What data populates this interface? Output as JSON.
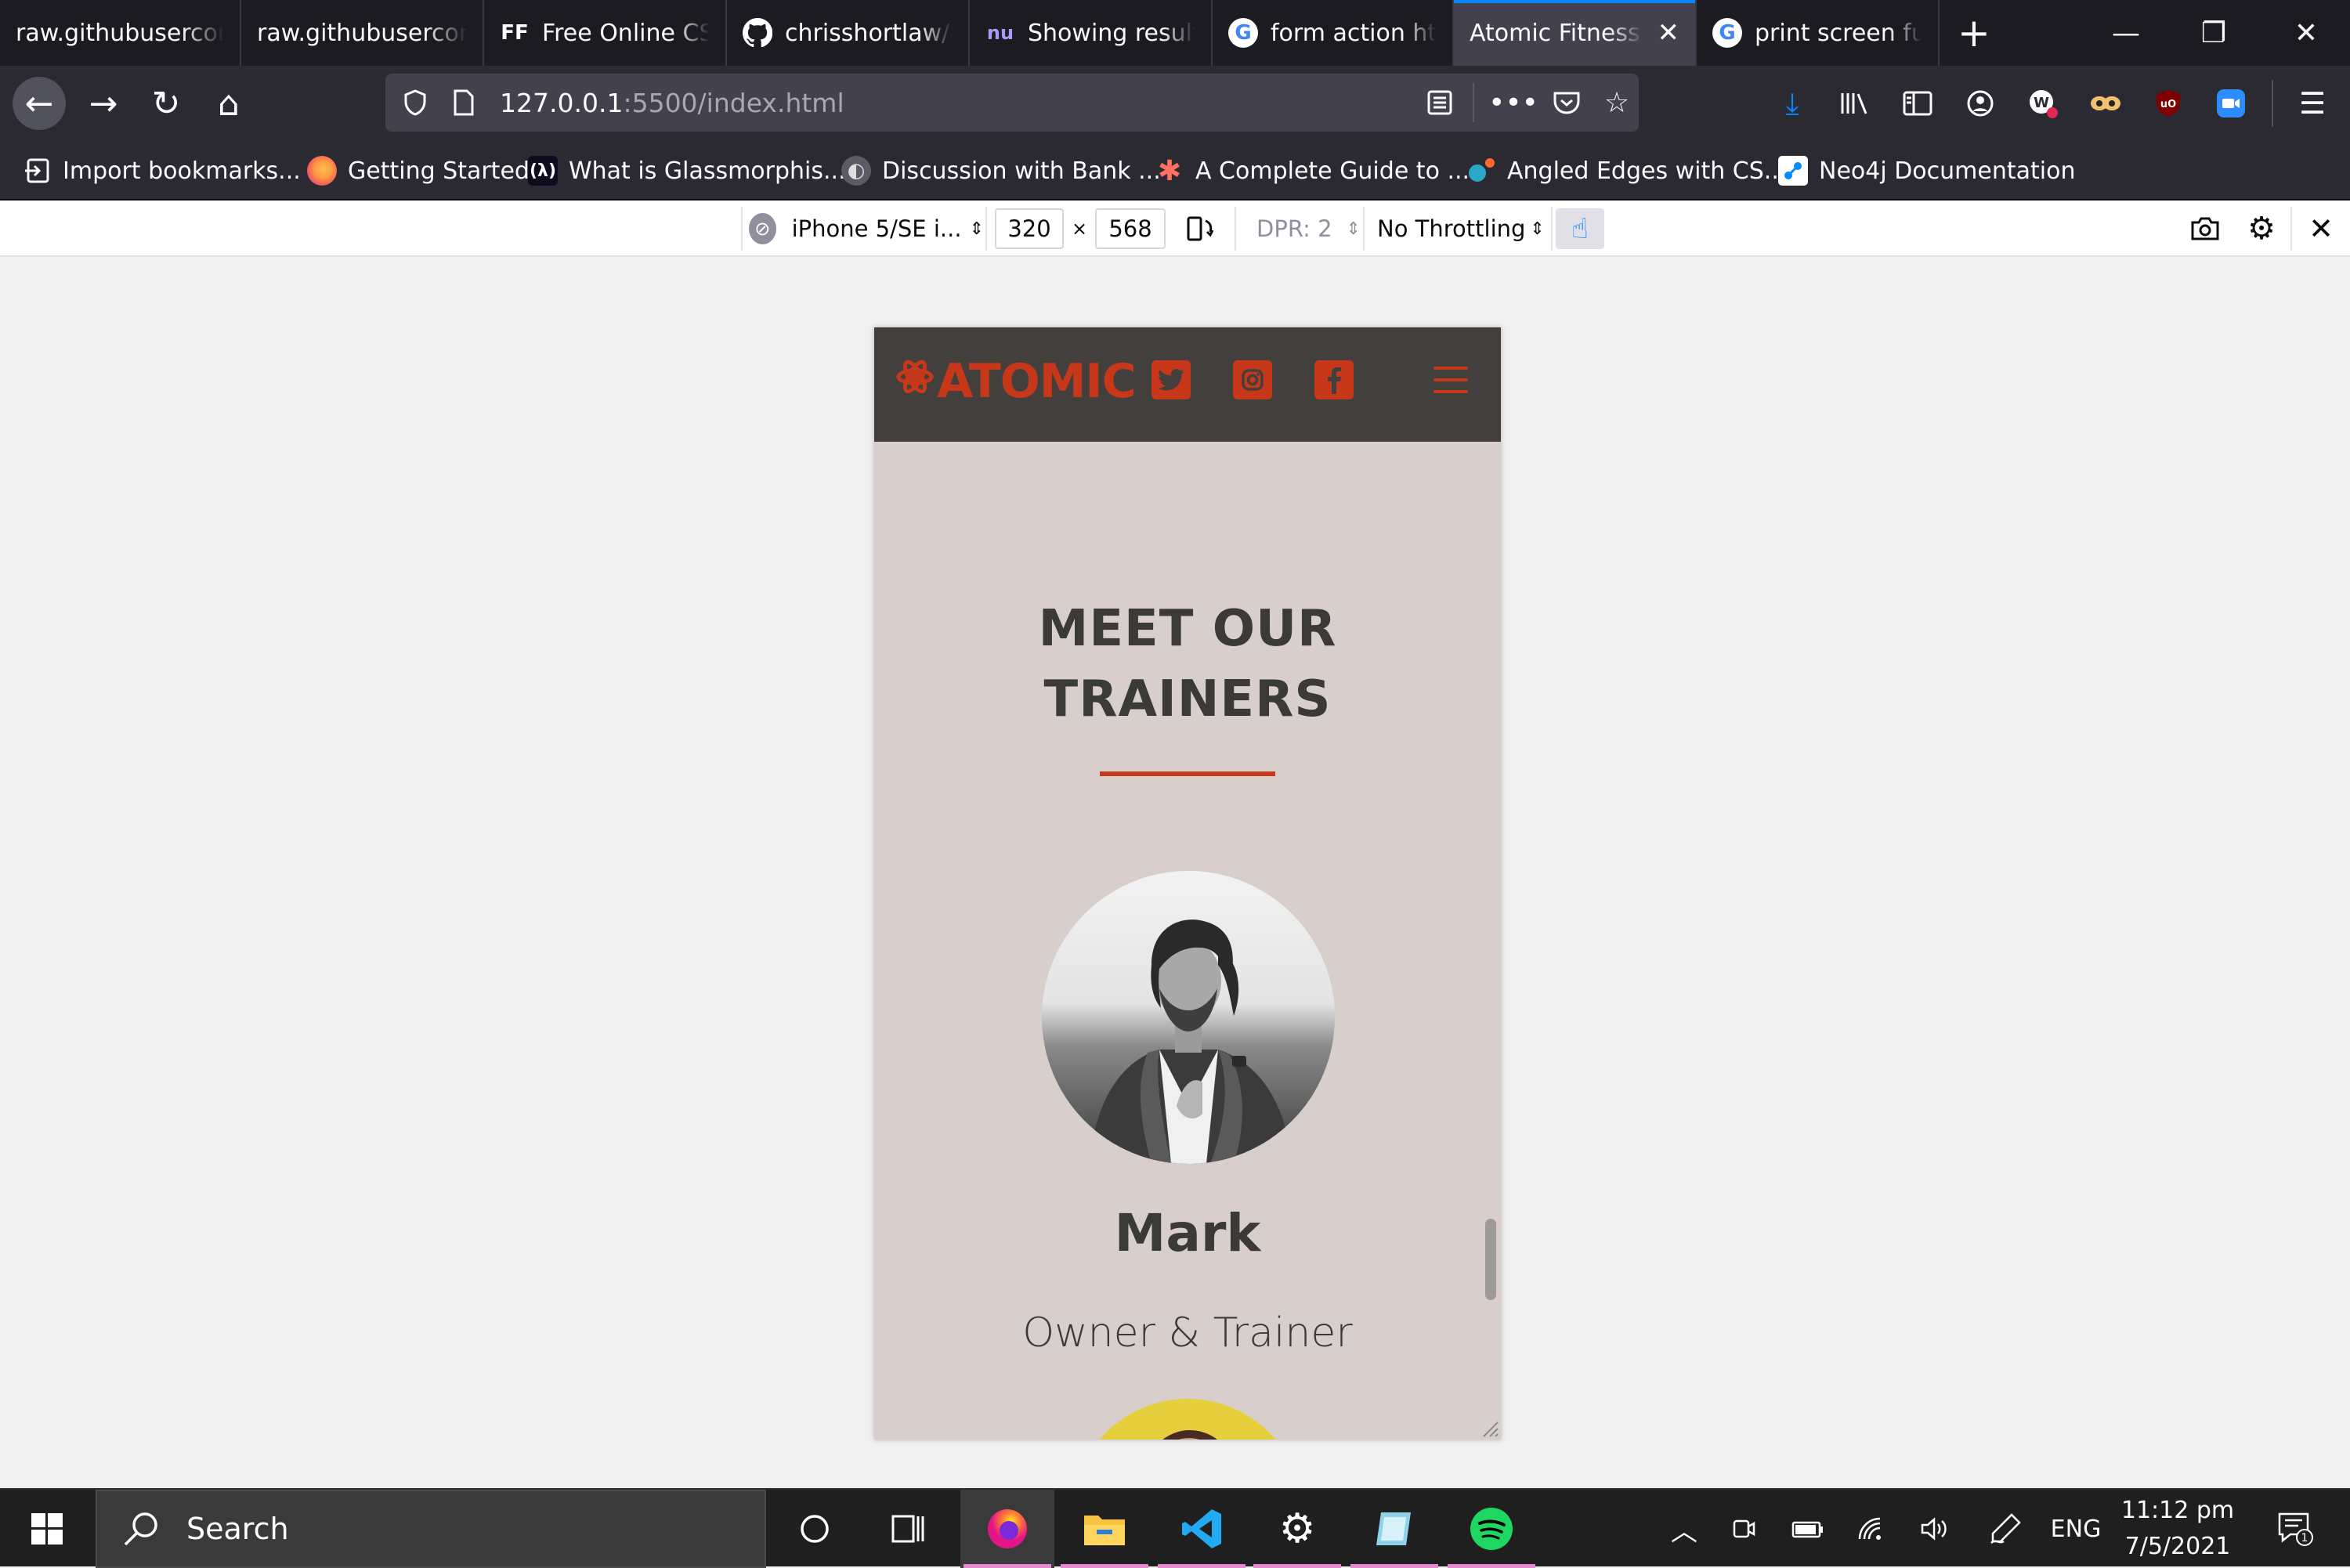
{
  "browser": {
    "tabs": [
      {
        "title": "raw.githubusercontent.com",
        "icon": "page-icon"
      },
      {
        "title": "raw.githubusercontent.com",
        "icon": "page-icon"
      },
      {
        "title": "Free Online CSS",
        "icon": "ff-icon",
        "favtext": "FF"
      },
      {
        "title": "chrisshortlaw/c",
        "icon": "github-icon"
      },
      {
        "title": "Showing results",
        "icon": "nu-icon",
        "favtext": "nu"
      },
      {
        "title": "form action htm",
        "icon": "google-icon",
        "favtext": "G"
      },
      {
        "title": "Atomic Fitness |",
        "icon": "none",
        "active": true
      },
      {
        "title": "print screen fun",
        "icon": "google-icon",
        "favtext": "G"
      }
    ],
    "url_host": "127.0.0.1",
    "url_path": ":5500/index.html",
    "bookmarks": [
      "Import bookmarks...",
      "Getting Started",
      "What is Glassmorphis...",
      "Discussion with Bank ...",
      "A Complete Guide to ...",
      "Angled Edges with CS...",
      "Neo4j Documentation"
    ],
    "accent_color": "#0a84ff"
  },
  "rdm": {
    "device": "iPhone 5/SE i...",
    "width": "320",
    "height": "568",
    "times": "×",
    "dpr": "DPR: 2",
    "throttling": "No Throttling"
  },
  "site": {
    "logo": "ATOMIC",
    "section_title_line1": "MEET OUR",
    "section_title_line2": "TRAINERS",
    "trainer_name": "Mark",
    "trainer_role": "Owner & Trainer",
    "brand_color": "#c63819",
    "header_color": "#433f3d",
    "background_color": "#d8cfcc"
  },
  "taskbar": {
    "search_placeholder": "Search",
    "language": "ENG",
    "time": "11:12 pm",
    "date": "7/5/2021",
    "notification_count": "1"
  }
}
